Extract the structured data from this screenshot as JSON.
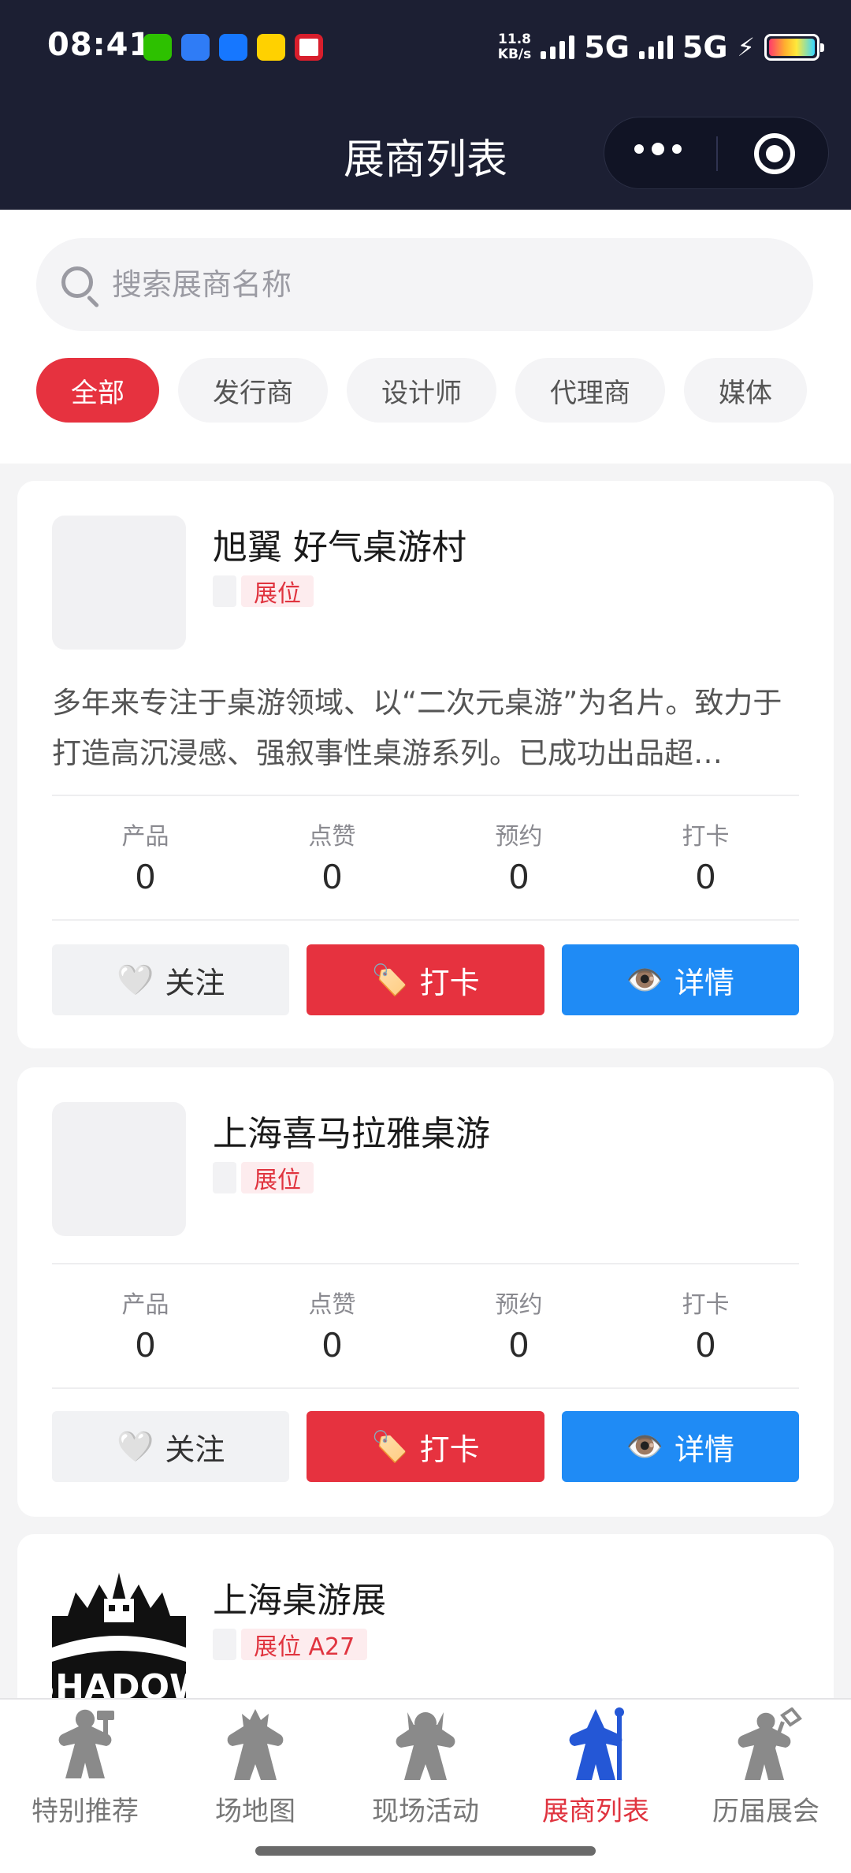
{
  "status_bar": {
    "time": "08:41",
    "speed_value": "11.8",
    "speed_unit": "KB/s",
    "network_1": "5G",
    "network_2": "5G"
  },
  "nav": {
    "title": "展商列表"
  },
  "search": {
    "placeholder": "搜索展商名称"
  },
  "filters": [
    {
      "label": "全部",
      "active": true
    },
    {
      "label": "发行商",
      "active": false
    },
    {
      "label": "设计师",
      "active": false
    },
    {
      "label": "代理商",
      "active": false
    },
    {
      "label": "媒体",
      "active": false
    }
  ],
  "exhibitors": [
    {
      "name": "旭翼 好气桌游村",
      "booth": "展位",
      "description": "多年来专注于桌游领域、以“二次元桌游”为名片。致力于打造高沉浸感、强叙事性桌游系列。已成功出品超…",
      "stats": [
        {
          "label": "产品",
          "value": "0"
        },
        {
          "label": "点赞",
          "value": "0"
        },
        {
          "label": "预约",
          "value": "0"
        },
        {
          "label": "打卡",
          "value": "0"
        }
      ],
      "buttons": {
        "follow": "关注",
        "checkin": "打卡",
        "detail": "详情"
      }
    },
    {
      "name": "上海喜马拉雅桌游",
      "booth": "展位",
      "description": "",
      "stats": [
        {
          "label": "产品",
          "value": "0"
        },
        {
          "label": "点赞",
          "value": "0"
        },
        {
          "label": "预约",
          "value": "0"
        },
        {
          "label": "打卡",
          "value": "0"
        }
      ],
      "buttons": {
        "follow": "关注",
        "checkin": "打卡",
        "detail": "详情"
      }
    },
    {
      "name": "上海桌游展",
      "booth": "展位 A27",
      "logo_text": "SHADOW"
    }
  ],
  "tabbar": [
    {
      "label": "特别推荐",
      "icon": "meeple-hammer-icon",
      "active": false
    },
    {
      "label": "场地图",
      "icon": "meeple-spiky-icon",
      "active": false
    },
    {
      "label": "现场活动",
      "icon": "meeple-viking-icon",
      "active": false
    },
    {
      "label": "展商列表",
      "icon": "meeple-wizard-icon",
      "active": true
    },
    {
      "label": "历届展会",
      "icon": "meeple-flag-icon",
      "active": false
    }
  ],
  "colors": {
    "accent_red": "#e6323f",
    "detail_blue": "#1f8bf5",
    "topbar": "#1c1f33"
  }
}
